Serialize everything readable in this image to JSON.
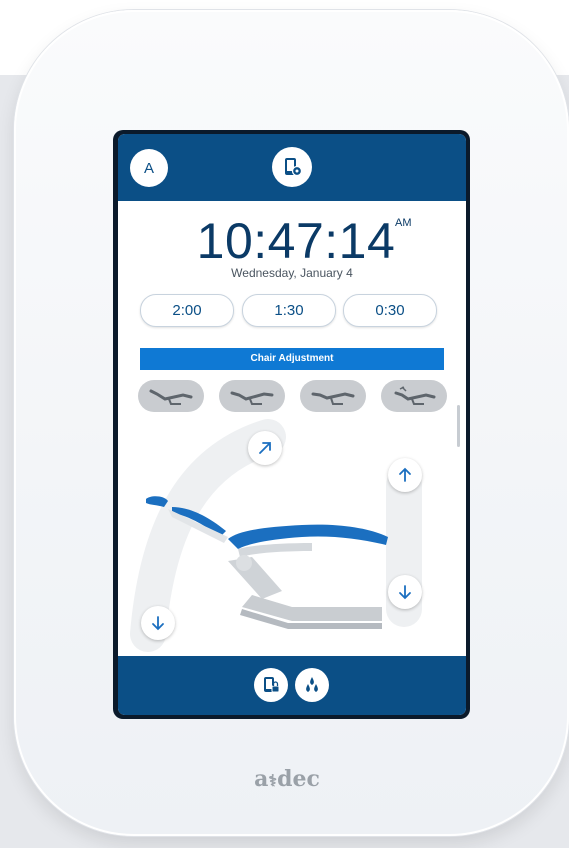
{
  "header": {
    "avatar_letter": "A",
    "settings_icon": "phone-settings-icon"
  },
  "clock": {
    "time": "10:47:14",
    "ampm": "AM",
    "date": "Wednesday, January 4"
  },
  "timers": [
    {
      "label": "2:00"
    },
    {
      "label": "1:30"
    },
    {
      "label": "0:30"
    }
  ],
  "section": {
    "title": "Chair Adjustment"
  },
  "presets": [
    {
      "icon": "chair-preset-recline-icon"
    },
    {
      "icon": "chair-preset-recline-icon"
    },
    {
      "icon": "chair-preset-recline-icon"
    },
    {
      "icon": "chair-preset-light-icon"
    }
  ],
  "controls": {
    "back_up_icon": "arrow-up-right-icon",
    "back_down_icon": "arrow-down-icon",
    "base_up_icon": "arrow-up-icon",
    "base_down_icon": "arrow-down-icon"
  },
  "footer": {
    "lock_icon": "phone-lock-icon",
    "water_icon": "water-drops-icon"
  },
  "brand": {
    "logo_text": "a dec"
  },
  "colors": {
    "primary": "#0b4f86",
    "accent": "#0f79d4",
    "chair_blue": "#1b6fc0"
  }
}
